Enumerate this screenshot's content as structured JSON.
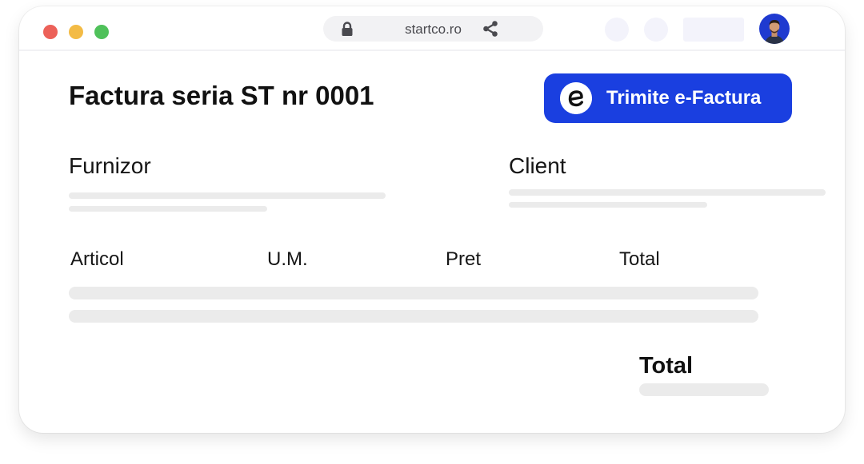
{
  "browser": {
    "url": "startco.ro",
    "icons": {
      "lock": "lock-icon",
      "share": "share-icon",
      "avatar": "user-avatar"
    }
  },
  "invoice": {
    "title": "Factura seria ST nr 0001",
    "send_button_label": "Trimite e-Factura",
    "supplier_label": "Furnizor",
    "client_label": "Client",
    "columns": [
      "Articol",
      "U.M.",
      "Pret",
      "Total"
    ],
    "total_label": "Total"
  },
  "colors": {
    "accent": "#1a3fe0",
    "placeholder": "#ebebeb",
    "dot_red": "#ec6159",
    "dot_yellow": "#f3bb45",
    "dot_green": "#4fc15a"
  }
}
